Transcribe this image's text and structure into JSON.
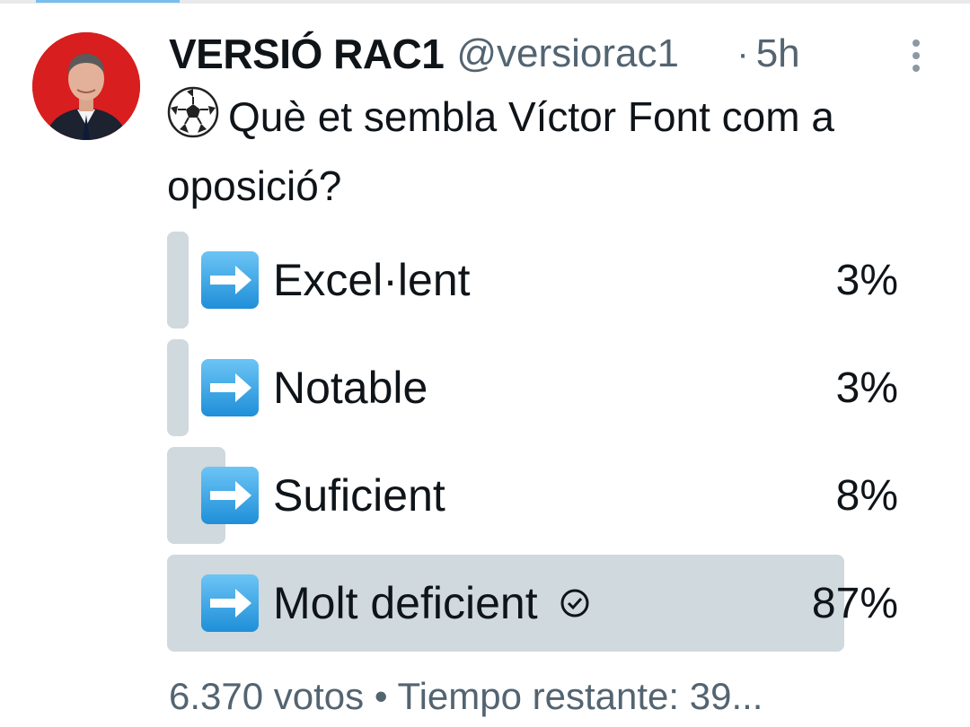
{
  "tweet": {
    "display_name": "VERSIÓ RAC1",
    "handle": "@versiorac1",
    "separator": "·",
    "time_ago": "5h",
    "text": "Què et sembla Víctor Font com a oposició?",
    "leading_icon": "soccer-ball-icon"
  },
  "poll": {
    "options": [
      {
        "label": "Excel·lent",
        "percent_text": "3%",
        "percent": 3,
        "selected": false
      },
      {
        "label": "Notable",
        "percent_text": "3%",
        "percent": 3,
        "selected": false
      },
      {
        "label": "Suficient",
        "percent_text": "8%",
        "percent": 8,
        "selected": false
      },
      {
        "label": "Molt deficient",
        "percent_text": "87%",
        "percent": 87,
        "selected": true
      }
    ],
    "votes": "6.370 votos",
    "bullet": "•",
    "time_remaining": "Tiempo restante: 39..."
  },
  "colors": {
    "bar_fill": "#cfd9de",
    "secondary_text": "#536471",
    "avatar_bg": "#d81e1e",
    "arrow_blue": "#2fa3e6"
  }
}
